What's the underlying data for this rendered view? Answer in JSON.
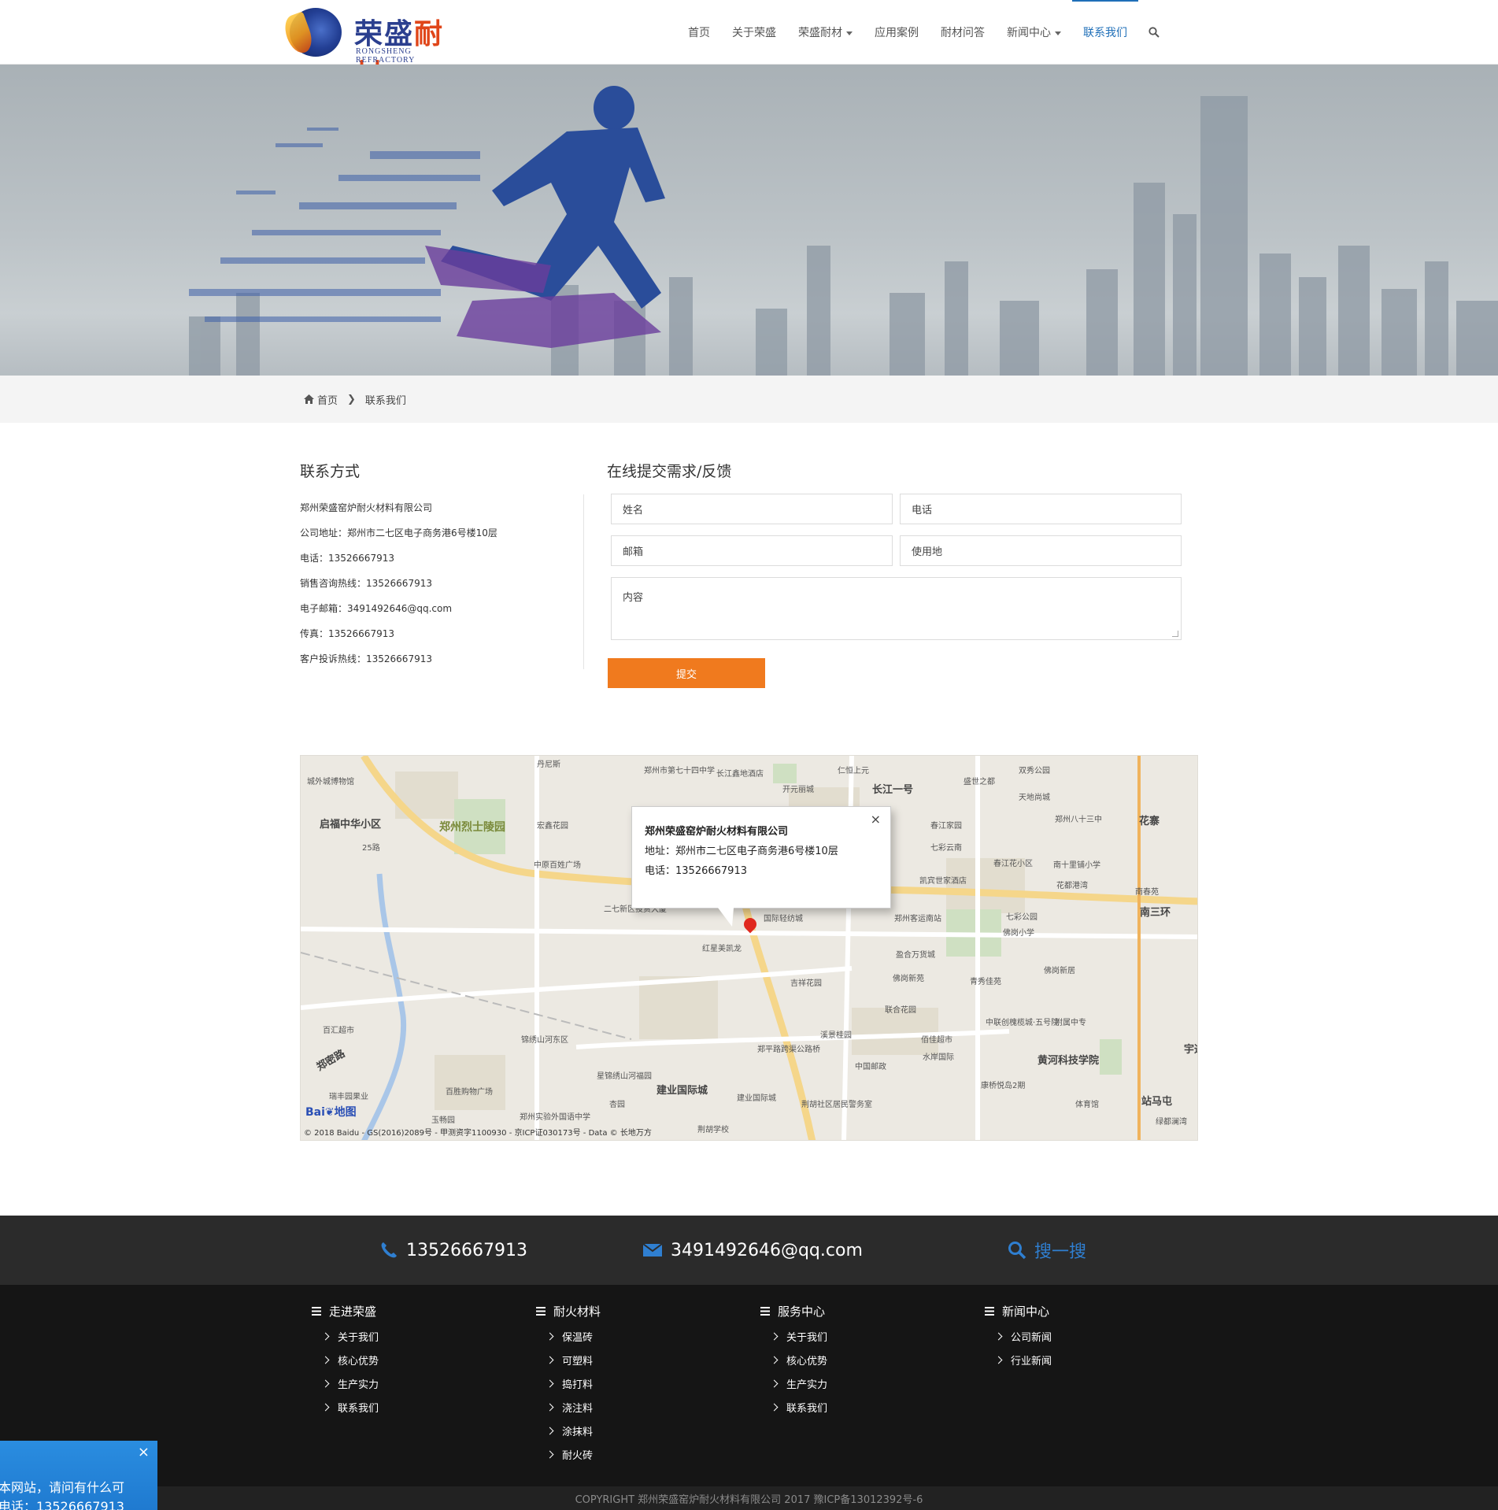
{
  "brand": {
    "name_a": "荣盛",
    "name_b": "耐材",
    "name_en": "RONGSHENG  REFRACTORY"
  },
  "nav": {
    "items": [
      {
        "label": "首页",
        "dropdown": false,
        "active": false
      },
      {
        "label": "关于荣盛",
        "dropdown": false,
        "active": false
      },
      {
        "label": "荣盛耐材",
        "dropdown": true,
        "active": false
      },
      {
        "label": "应用案例",
        "dropdown": false,
        "active": false
      },
      {
        "label": "耐材问答",
        "dropdown": false,
        "active": false
      },
      {
        "label": "新闻中心",
        "dropdown": true,
        "active": false
      },
      {
        "label": "联系我们",
        "dropdown": false,
        "active": true
      }
    ],
    "search_icon": "search-icon"
  },
  "breadcrumb": {
    "home": "首页",
    "current": "联系我们"
  },
  "contact": {
    "title": "联系方式",
    "items": [
      "郑州荣盛窑炉耐火材料有限公司",
      "公司地址：郑州市二七区电子商务港6号楼10层",
      "电话：13526667913",
      "销售咨询热线：13526667913",
      "电子邮箱：3491492646@qq.com",
      "传真：13526667913",
      "客户投诉热线：13526667913"
    ]
  },
  "form": {
    "title": "在线提交需求/反馈",
    "name_placeholder": "姓名",
    "phone_placeholder": "电话",
    "email_placeholder": "邮箱",
    "location_placeholder": "使用地",
    "content_placeholder": "内容",
    "submit_label": "提交"
  },
  "map": {
    "popup_title": "郑州荣盛窑炉耐火材料有限公司",
    "popup_address": "地址：郑州市二七区电子商务港6号楼10层",
    "popup_phone": "电话：13526667913",
    "close_label": "×",
    "logo_a": "Bai",
    "logo_b": "地图",
    "copyright": "© 2018 Baidu - GS(2016)2089号 - 甲测资字1100930 - 京ICP证030173号 - Data © 长地万方",
    "labels": [
      {
        "text": "城外城博物馆",
        "kind": "small"
      },
      {
        "text": "启福中华小区",
        "kind": "big"
      },
      {
        "text": "郑州烈士陵园",
        "kind": "green"
      },
      {
        "text": "25路",
        "kind": "small"
      },
      {
        "text": "丹尼斯",
        "kind": "small"
      },
      {
        "text": "郑州市第七十四中学",
        "kind": "small"
      },
      {
        "text": "长江鑫地酒店",
        "kind": "small"
      },
      {
        "text": "仁恒上元",
        "kind": "small"
      },
      {
        "text": "开元丽城",
        "kind": "small"
      },
      {
        "text": "长江一号",
        "kind": "big"
      },
      {
        "text": "盛世之都",
        "kind": "small"
      },
      {
        "text": "双秀公园",
        "kind": "small"
      },
      {
        "text": "天地尚城",
        "kind": "small"
      },
      {
        "text": "郑州八十三中",
        "kind": "small"
      },
      {
        "text": "花寨",
        "kind": "big"
      },
      {
        "text": "宏鑫花园",
        "kind": "small"
      },
      {
        "text": "春江家园",
        "kind": "small"
      },
      {
        "text": "七彩云南",
        "kind": "small"
      },
      {
        "text": "春江花小区",
        "kind": "small"
      },
      {
        "text": "南十里铺小学",
        "kind": "small"
      },
      {
        "text": "中原百姓广场",
        "kind": "small"
      },
      {
        "text": "凯宾世家酒店",
        "kind": "small"
      },
      {
        "text": "花都港湾",
        "kind": "small"
      },
      {
        "text": "南春苑",
        "kind": "small"
      },
      {
        "text": "南三环",
        "kind": "big"
      },
      {
        "text": "二七新区投资大厦",
        "kind": "small"
      },
      {
        "text": "国际轻纺城",
        "kind": "small"
      },
      {
        "text": "郑州客运南站",
        "kind": "small"
      },
      {
        "text": "七彩公园",
        "kind": "small"
      },
      {
        "text": "佛岗小学",
        "kind": "small"
      },
      {
        "text": "红星美凯龙",
        "kind": "small"
      },
      {
        "text": "盈合万货城",
        "kind": "small"
      },
      {
        "text": "佛岗新居",
        "kind": "small"
      },
      {
        "text": "吉祥花园",
        "kind": "small"
      },
      {
        "text": "佛岗新苑",
        "kind": "small"
      },
      {
        "text": "青秀佳苑",
        "kind": "small"
      },
      {
        "text": "联合花园",
        "kind": "small"
      },
      {
        "text": "附属中专",
        "kind": "small"
      },
      {
        "text": "百汇超市",
        "kind": "small"
      },
      {
        "text": "中联创槐榄城·五号院",
        "kind": "small"
      },
      {
        "text": "锦绣山河东区",
        "kind": "small"
      },
      {
        "text": "溪景桂园",
        "kind": "small"
      },
      {
        "text": "佰佳超市",
        "kind": "small"
      },
      {
        "text": "郑密路",
        "kind": "big"
      },
      {
        "text": "郑平路跨渠公路桥",
        "kind": "small"
      },
      {
        "text": "中国邮政",
        "kind": "small"
      },
      {
        "text": "水岸国际",
        "kind": "small"
      },
      {
        "text": "黄河科技学院",
        "kind": "big"
      },
      {
        "text": "星锦绣山河福园",
        "kind": "small"
      },
      {
        "text": "建业国际城",
        "kind": "big"
      },
      {
        "text": "康桥悦岛2期",
        "kind": "small"
      },
      {
        "text": "瑞丰园果业",
        "kind": "small"
      },
      {
        "text": "百胜购物广场",
        "kind": "small"
      },
      {
        "text": "杏园",
        "kind": "small"
      },
      {
        "text": "建业国际城",
        "kind": "small"
      },
      {
        "text": "荆胡社区居民警务室",
        "kind": "small"
      },
      {
        "text": "体育馆",
        "kind": "small"
      },
      {
        "text": "站马屯",
        "kind": "big"
      },
      {
        "text": "郑州实验外国语中学",
        "kind": "small"
      },
      {
        "text": "荆胡学校",
        "kind": "small"
      },
      {
        "text": "绿都澜湾",
        "kind": "small"
      },
      {
        "text": "玉畅园",
        "kind": "small"
      },
      {
        "text": "宇通",
        "kind": "big"
      }
    ]
  },
  "footer": {
    "phone": "13526667913",
    "email": "3491492646@qq.com",
    "search_label": "搜一搜",
    "columns": [
      {
        "title": "走进荣盛",
        "links": [
          "关于我们",
          "核心优势",
          "生产实力",
          "联系我们"
        ]
      },
      {
        "title": "耐火材料",
        "links": [
          "保温砖",
          "可塑料",
          "捣打料",
          "浇注料",
          "涂抹料",
          "耐火砖"
        ]
      },
      {
        "title": "服务中心",
        "links": [
          "关于我们",
          "核心优势",
          "生产实力",
          "联系我们"
        ]
      },
      {
        "title": "新闻中心",
        "links": [
          "公司新闻",
          "行业新闻"
        ]
      }
    ],
    "copyright": "COPYRIGHT 郑州荣盛窑炉耐火材料有限公司 2017 豫ICP备13012392号-6"
  },
  "chat": {
    "line1": "本网站，请问有什么可",
    "line2": "电话：13526667913",
    "close_label": "×"
  },
  "colors": {
    "accent": "#1f6fb8",
    "submit": "#f07a1e",
    "footer_dark": "#151515",
    "footer_top": "#2b2b2b"
  }
}
